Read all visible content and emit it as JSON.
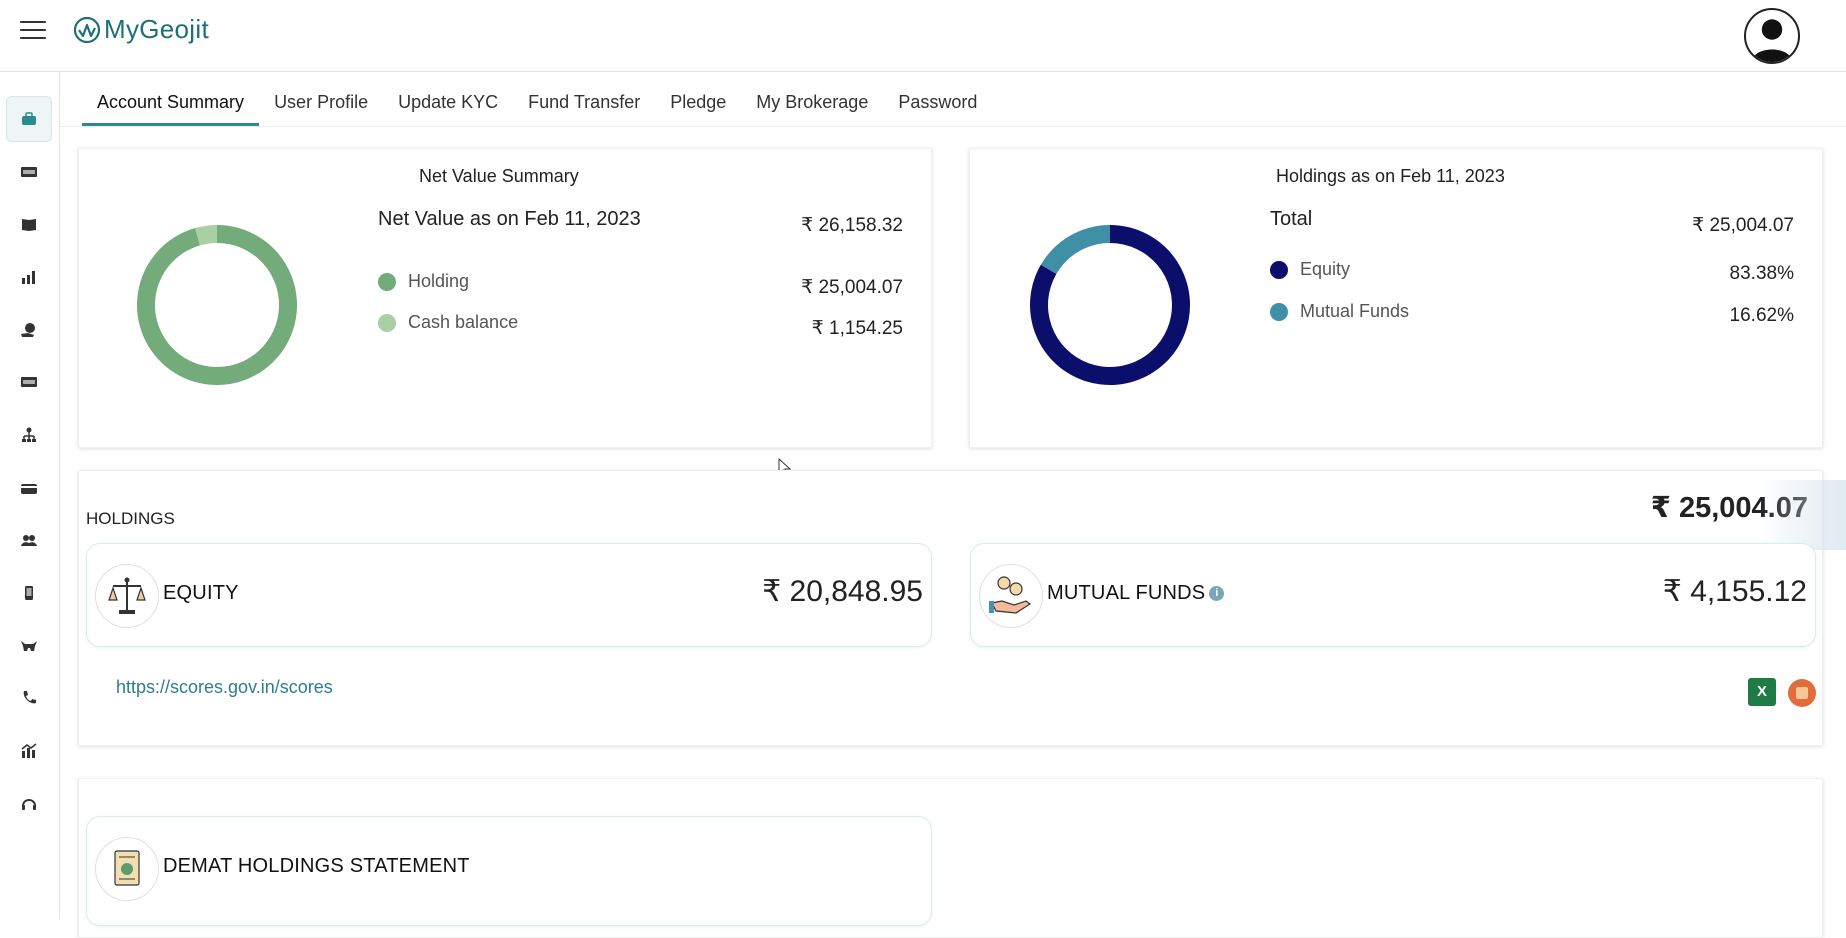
{
  "app": {
    "logo_text": "MyGeojit"
  },
  "tabs": [
    {
      "label": "Account Summary",
      "active": true
    },
    {
      "label": "User Profile"
    },
    {
      "label": "Update KYC"
    },
    {
      "label": "Fund Transfer"
    },
    {
      "label": "Pledge"
    },
    {
      "label": "My Brokerage"
    },
    {
      "label": "Password"
    }
  ],
  "sidebar": {
    "icons": [
      "portfolio-icon",
      "ipo-icon",
      "book-icon",
      "bar-chart-icon",
      "pie-hand-icon",
      "ipo-alt-icon",
      "hierarchy-icon",
      "card-icon",
      "users-icon",
      "mobile-icon",
      "bull-icon",
      "phone-icon",
      "market-chart-icon",
      "headset-icon"
    ]
  },
  "net_value": {
    "title": "Net Value Summary",
    "subtitle": "Net Value as on Feb 11, 2023",
    "total": "₹ 26,158.32",
    "items": [
      {
        "label": "Holding",
        "value": "₹ 25,004.07",
        "color": "#74ab7a",
        "share": 0.9559
      },
      {
        "label": "Cash balance",
        "value": "₹ 1,154.25",
        "color": "#a9cfa5",
        "share": 0.0441
      }
    ]
  },
  "holdings_summary": {
    "title": "Holdings as on Feb 11, 2023",
    "total_label": "Total",
    "total": "₹ 25,004.07",
    "items": [
      {
        "label": "Equity",
        "value": "83.38%",
        "color": "#0b0f6b",
        "share": 0.8338
      },
      {
        "label": "Mutual Funds",
        "value": "16.62%",
        "color": "#3f8fa6",
        "share": 0.1662
      }
    ]
  },
  "holdings": {
    "label": "HOLDINGS",
    "total": "₹ 25,004.07",
    "equity": {
      "label": "EQUITY",
      "value": "₹ 20,848.95"
    },
    "mutual_funds": {
      "label": "MUTUAL FUNDS",
      "value": "₹ 4,155.12",
      "info": "i"
    },
    "link": "https://scores.gov.in/scores",
    "excel_label": "X"
  },
  "demat": {
    "label": "DEMAT HOLDINGS STATEMENT"
  },
  "colors": {
    "accent": "#2a8a8f",
    "link": "#2e7d8e"
  }
}
